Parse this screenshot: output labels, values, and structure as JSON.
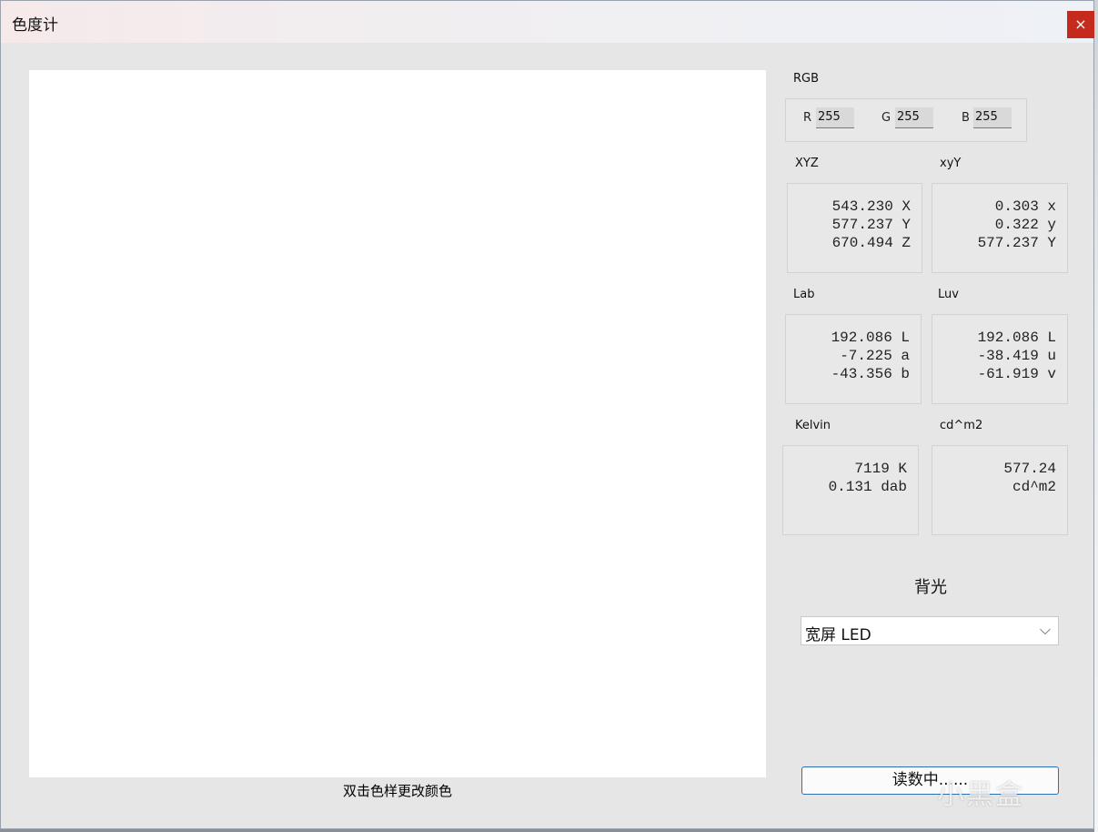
{
  "window": {
    "title": "色度计",
    "close_glyph": "×"
  },
  "swatch": {
    "color": "#ffffff",
    "caption": "双击色样更改颜色"
  },
  "rgb": {
    "label": "RGB",
    "r_label": "R",
    "r_value": "255",
    "g_label": "G",
    "g_value": "255",
    "b_label": "B",
    "b_value": "255"
  },
  "xyz": {
    "label": "XYZ",
    "lines": [
      "543.230 X",
      "577.237 Y",
      "670.494 Z"
    ]
  },
  "xyy": {
    "label": "xyY",
    "lines": [
      "0.303 x",
      "0.322 y",
      "577.237 Y"
    ]
  },
  "lab": {
    "label": "Lab",
    "lines": [
      "192.086 L",
      "-7.225 a",
      "-43.356 b"
    ]
  },
  "luv": {
    "label": "Luv",
    "lines": [
      "192.086 L",
      "-38.419 u",
      "-61.919 v"
    ]
  },
  "kelvin": {
    "label": "Kelvin",
    "lines": [
      "7119 K",
      "0.131 dab"
    ]
  },
  "luminance": {
    "label": "cd^m2",
    "lines": [
      "577.24",
      "cd^m2"
    ]
  },
  "backlight": {
    "title": "背光",
    "selected": "宽屏 LED",
    "chevron_glyph": "⌵"
  },
  "read_button": {
    "label": "读数中......"
  },
  "watermark": {
    "text": "小黑盒"
  },
  "colors": {
    "close_button": "#c42b1c",
    "button_border": "#2e6fb5"
  }
}
